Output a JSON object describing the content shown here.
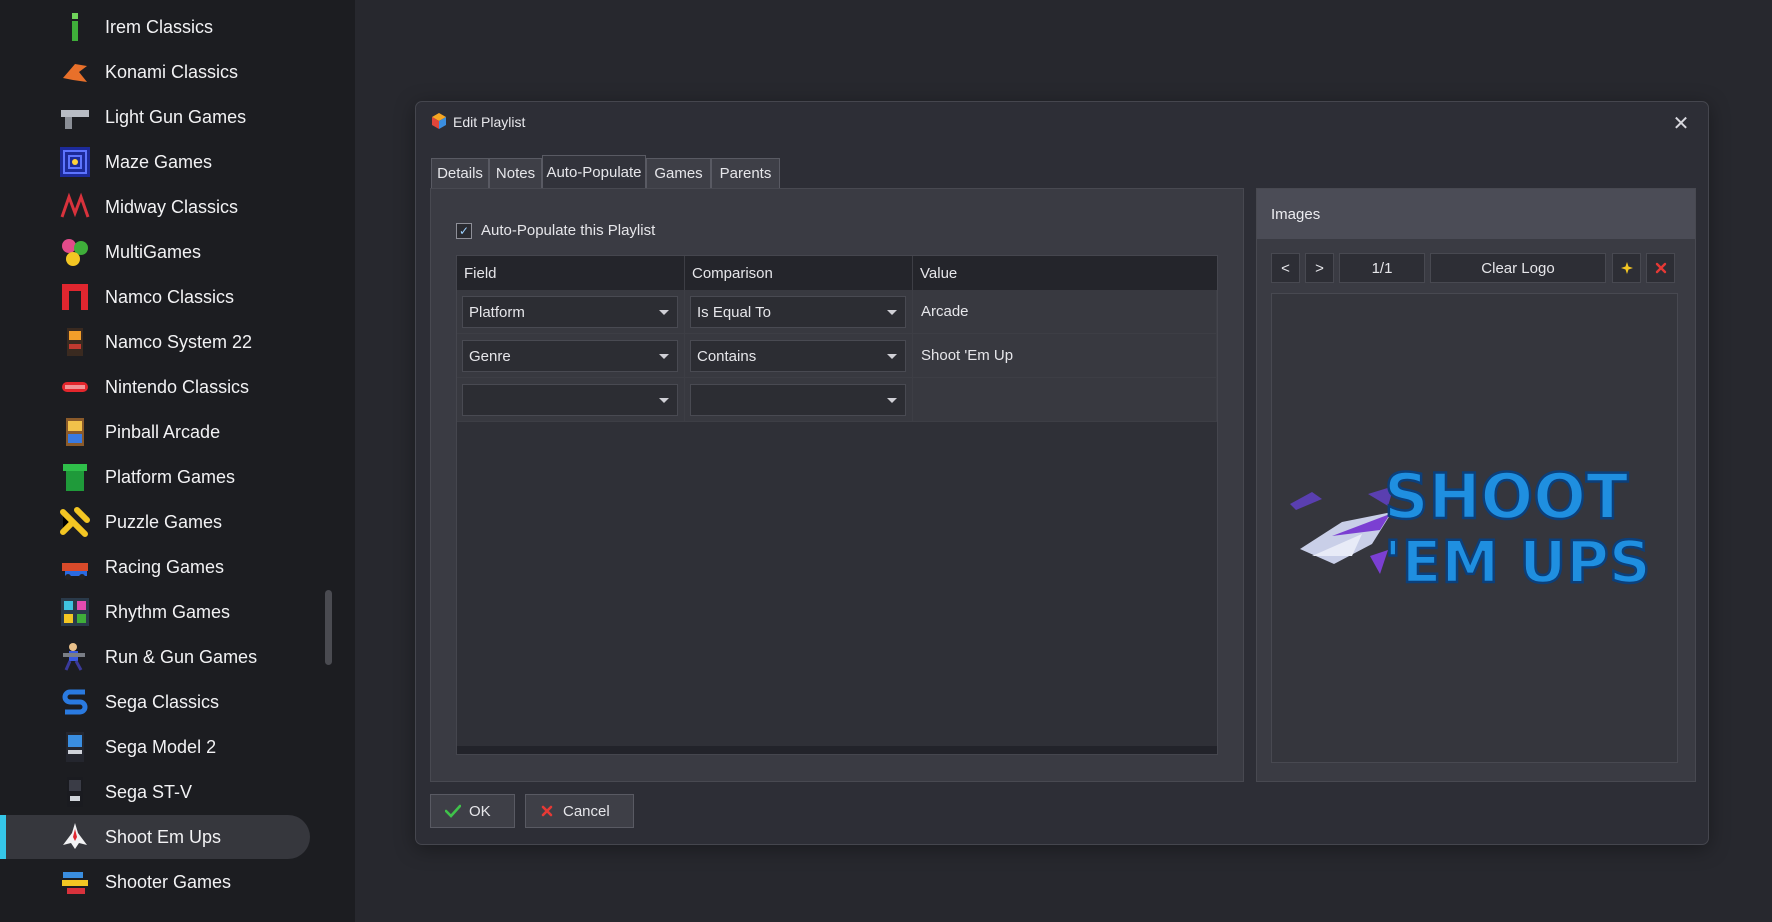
{
  "sidebar": {
    "items": [
      {
        "label": "Irem Classics",
        "icon": "irem-icon"
      },
      {
        "label": "Konami Classics",
        "icon": "konami-icon"
      },
      {
        "label": "Light Gun Games",
        "icon": "light-gun-icon"
      },
      {
        "label": "Maze Games",
        "icon": "maze-icon"
      },
      {
        "label": "Midway Classics",
        "icon": "midway-icon"
      },
      {
        "label": "MultiGames",
        "icon": "multigames-icon"
      },
      {
        "label": "Namco Classics",
        "icon": "namco-icon"
      },
      {
        "label": "Namco System 22",
        "icon": "namco-system22-icon"
      },
      {
        "label": "Nintendo Classics",
        "icon": "nintendo-icon"
      },
      {
        "label": "Pinball Arcade",
        "icon": "pinball-icon"
      },
      {
        "label": "Platform Games",
        "icon": "platform-pipe-icon"
      },
      {
        "label": "Puzzle Games",
        "icon": "puzzle-icon"
      },
      {
        "label": "Racing Games",
        "icon": "racing-icon"
      },
      {
        "label": "Rhythm Games",
        "icon": "rhythm-icon"
      },
      {
        "label": "Run & Gun Games",
        "icon": "run-gun-icon"
      },
      {
        "label": "Sega Classics",
        "icon": "sega-icon"
      },
      {
        "label": "Sega Model 2",
        "icon": "sega-model2-icon"
      },
      {
        "label": "Sega ST-V",
        "icon": "sega-stv-icon"
      },
      {
        "label": "Shoot Em Ups",
        "icon": "ship-icon",
        "active": true
      },
      {
        "label": "Shooter Games",
        "icon": "shooter-icon"
      }
    ]
  },
  "dialog": {
    "title": "Edit Playlist",
    "tabs": [
      "Details",
      "Notes",
      "Auto-Populate",
      "Games",
      "Parents"
    ],
    "active_tab": "Auto-Populate",
    "autopopulate_label": "Auto-Populate this Playlist",
    "autopopulate_checked": true,
    "grid": {
      "headers": [
        "Field",
        "Comparison",
        "Value"
      ],
      "rows": [
        {
          "field": "Platform",
          "comparison": "Is Equal To",
          "value": "Arcade"
        },
        {
          "field": "Genre",
          "comparison": "Contains",
          "value": "Shoot 'Em Up"
        },
        {
          "field": "",
          "comparison": "",
          "value": ""
        }
      ]
    },
    "images": {
      "title": "Images",
      "prev": "<",
      "next": ">",
      "counter": "1/1",
      "clear_label": "Clear Logo",
      "logo_text_line1": "SHOOT",
      "logo_text_line2": "'EM UPS"
    },
    "ok_label": "OK",
    "cancel_label": "Cancel"
  },
  "colors": {
    "accent": "#35c6e8",
    "ok_green": "#3fc24a",
    "cancel_red": "#e53935",
    "logo_blue": "#1f8fe0"
  }
}
